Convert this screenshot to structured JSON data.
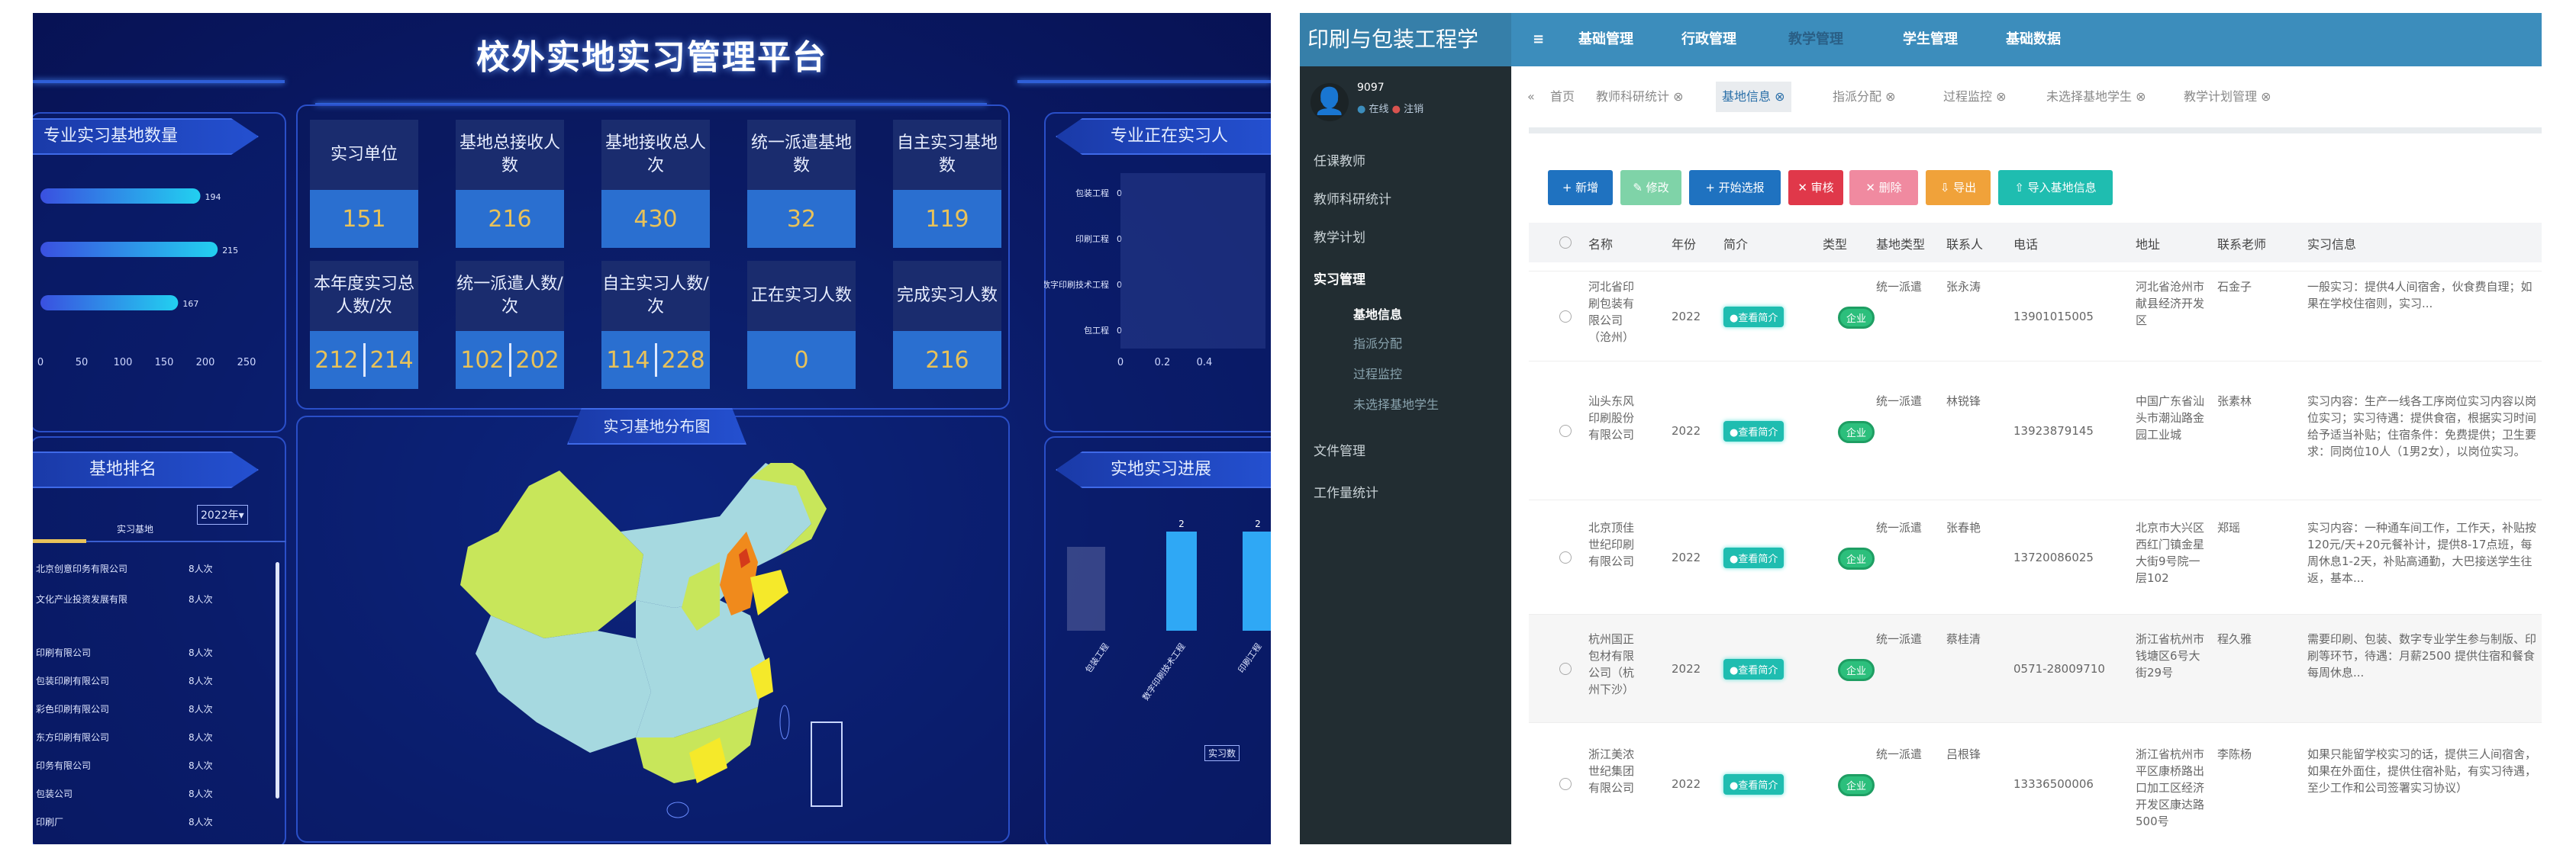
{
  "dashboard": {
    "title": "校外实地实习管理平台",
    "cards": [
      {
        "label": "实习单位",
        "value": "151"
      },
      {
        "label": "基地总接收人数",
        "value": "216"
      },
      {
        "label": "基地接收总人次",
        "value": "430"
      },
      {
        "label": "统一派遣基地数",
        "value": "32"
      },
      {
        "label": "自主实习基地数",
        "value": "119"
      },
      {
        "label": "本年度实习总人数/次",
        "value_a": "212",
        "value_b": "214"
      },
      {
        "label": "统一派遣人数/次",
        "value_a": "102",
        "value_b": "202"
      },
      {
        "label": "自主实习人数/次",
        "value_a": "114",
        "value_b": "228"
      },
      {
        "label": "正在实习人数",
        "value": "0"
      },
      {
        "label": "完成实习人数",
        "value": "216"
      }
    ],
    "panels": {
      "base_count": "专业实习基地数量",
      "current_interns": "专业正在实习人",
      "ranking": "基地排名",
      "map": "实习基地分布图",
      "progress": "实地实习进展"
    },
    "ranking": {
      "year_select": "2022年▾",
      "tab": "实习基地",
      "items": [
        {
          "name": "北京创意印务有限公司",
          "count": "8人次"
        },
        {
          "name": "文化产业投资发展有限",
          "count": "8人次"
        },
        {
          "name": "印刷有限公司",
          "count": "8人次"
        },
        {
          "name": "包装印刷有限公司",
          "count": "8人次"
        },
        {
          "name": "彩色印刷有限公司",
          "count": "8人次"
        },
        {
          "name": "东方印刷有限公司",
          "count": "8人次"
        },
        {
          "name": "印务有限公司",
          "count": "8人次"
        },
        {
          "name": "包装公司",
          "count": "8人次"
        },
        {
          "name": "印刷厂",
          "count": "8人次"
        }
      ]
    },
    "map_colors": {
      "low": "#a6d9e0",
      "mid": "#c8e65a",
      "high": "#f5e92a",
      "peak": "#f08a1c",
      "max": "#d43a1a"
    }
  },
  "chart_data": [
    {
      "type": "bar",
      "orientation": "horizontal",
      "title": "专业实习基地数量",
      "values": [
        194,
        215,
        167
      ],
      "xlim": [
        0,
        250
      ],
      "xticks": [
        0,
        50,
        100,
        150,
        200,
        250
      ],
      "data_labels": [
        "194",
        "215",
        "167"
      ]
    },
    {
      "type": "bar",
      "orientation": "horizontal",
      "title": "专业正在实习人",
      "categories": [
        "包装工程",
        "印刷工程",
        "数字印刷技术工程",
        "包工程"
      ],
      "values": [
        0,
        0,
        0,
        0
      ],
      "xticks": [
        "0",
        "0.2",
        "0.4"
      ]
    },
    {
      "type": "bar",
      "title": "实地实习进展",
      "categories": [
        "包装工程",
        "数字印刷技术工程",
        "印刷工程"
      ],
      "series": [
        {
          "name": "实习数",
          "values": [
            null,
            2,
            2
          ]
        }
      ],
      "data_labels": [
        "2",
        "2"
      ]
    }
  ],
  "admin": {
    "brand": "印刷与包装工程学",
    "nav": [
      "≡",
      "基础管理",
      "行政管理",
      "教学管理",
      "学生管理",
      "基础数据"
    ],
    "user": {
      "name": "9097",
      "online": "在线",
      "logout": "注销"
    },
    "sidebar": [
      {
        "label": "任课教师"
      },
      {
        "label": "教师科研统计"
      },
      {
        "label": "教学计划"
      },
      {
        "label": "实习管理"
      },
      {
        "label": "基地信息",
        "sub": true
      },
      {
        "label": "指派分配",
        "sub": true
      },
      {
        "label": "过程监控",
        "sub": true
      },
      {
        "label": "未选择基地学生",
        "sub": true
      },
      {
        "label": "文件管理"
      },
      {
        "label": "工作量统计"
      }
    ],
    "tabs": [
      "首页",
      "教师科研统计 ⊗",
      "基地信息 ⊗",
      "指派分配 ⊗",
      "过程监控 ⊗",
      "未选择基地学生 ⊗",
      "教学计划管理 ⊗"
    ],
    "buttons": [
      {
        "label": "+ 新增",
        "color": "#1f72c0"
      },
      {
        "label": "✎ 修改",
        "color": "#7fd3a8"
      },
      {
        "label": "+ 开始选报",
        "color": "#1f72c0"
      },
      {
        "label": "✕ 审核",
        "color": "#e0384a"
      },
      {
        "label": "✕ 删除",
        "color": "#f08aa0"
      },
      {
        "label": "⇩ 导出",
        "color": "#f0a23a"
      },
      {
        "label": "⇧ 导入基地信息",
        "color": "#1fbdb0"
      }
    ],
    "columns": [
      "名称",
      "年份",
      "简介",
      "类型",
      "基地类型",
      "联系人",
      "电话",
      "地址",
      "联系老师",
      "实习信息"
    ],
    "rows": [
      {
        "name": "河北省印刷包装有限公司（沧州）",
        "year": "2022",
        "intro": "●查看简介",
        "type": "企业",
        "base": "统一派遣",
        "contact": "张永涛",
        "phone": "13901015005",
        "address": "河北省沧州市献县经济开发区",
        "teacher": "石金子",
        "info": "一般实习：提供4人间宿舍，伙食费自理；如果在学校住宿则，实习..."
      },
      {
        "name": "汕头东风印刷股份有限公司",
        "year": "2022",
        "intro": "●查看简介",
        "type": "企业",
        "base": "统一派遣",
        "contact": "林锐锋",
        "phone": "13923879145",
        "address": "中国广东省汕头市潮汕路金园工业城",
        "teacher": "张素林",
        "info": "实习内容：生产一线各工序岗位实习内容以岗位实习；实习待遇：提供食宿，根据实习时间给予适当补贴；住宿条件：免费提供；卫生要求：同岗位10人（1男2女），以岗位实习。"
      },
      {
        "name": "北京顶佳世纪印刷有限公司",
        "year": "2022",
        "intro": "●查看简介",
        "type": "企业",
        "base": "统一派遣",
        "contact": "张春艳",
        "phone": "13720086025",
        "address": "北京市大兴区西红门镇金星大街9号院一层102",
        "teacher": "郑瑶",
        "info": "实习内容：一种通车间工作，工作天，补贴按120元/天+20元餐补计，提供8-17点班，每周休息1-2天，补贴高通勤，大巴接送学生往返，基本..."
      },
      {
        "name": "杭州国正包材有限公司（杭州下沙）",
        "year": "2022",
        "intro": "●查看简介",
        "type": "企业",
        "base": "统一派遣",
        "contact": "蔡桂清",
        "phone": "0571-28009710",
        "address": "浙江省杭州市钱塘区6号大街29号",
        "teacher": "程久雅",
        "info": "需要印刷、包装、数字专业学生参与制版、印刷等环节，待遇：月薪2500 提供住宿和餐食 每周休息..."
      },
      {
        "name": "浙江美浓世纪集团有限公司",
        "year": "2022",
        "intro": "●查看简介",
        "type": "企业",
        "base": "统一派遣",
        "contact": "吕根锋",
        "phone": "13336500006",
        "address": "浙江省杭州市平区康桥路出口加工区经济开发区康达路500号",
        "teacher": "李陈杨",
        "info": "如果只能留学校实习的话，提供三人间宿舍，如果在外面住，提供住宿补贴，有实习待遇，至少工作和公司签署实习协议）"
      }
    ]
  }
}
